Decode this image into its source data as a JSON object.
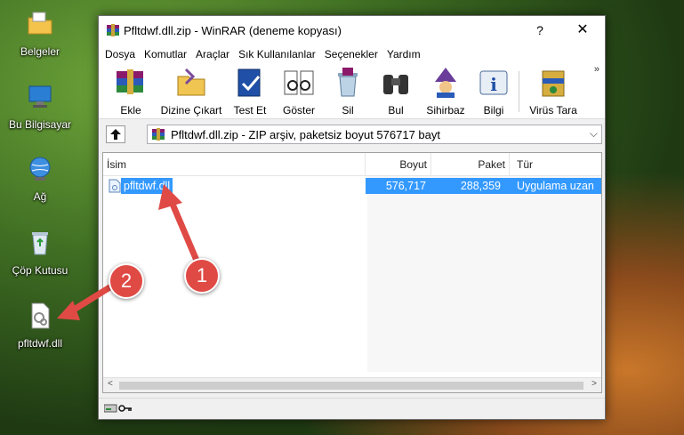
{
  "desktop": {
    "icons": [
      {
        "label": "Belgeler",
        "icon": "folder-icon"
      },
      {
        "label": "Bu Bilgisayar",
        "icon": "computer-icon"
      },
      {
        "label": "Ağ",
        "icon": "network-icon"
      },
      {
        "label": "Çöp Kutusu",
        "icon": "recycle-bin-icon"
      },
      {
        "label": "pfltdwf.dll",
        "icon": "dll-file-icon"
      }
    ]
  },
  "window": {
    "title": "Pfltdwf.dll.zip - WinRAR (deneme kopyası)",
    "help_label": "?",
    "close_label": "✕",
    "menu": [
      "Dosya",
      "Komutlar",
      "Araçlar",
      "Sık Kullanılanlar",
      "Seçenekler",
      "Yardım"
    ],
    "toolbar": [
      {
        "label": "Ekle",
        "icon": "add-archive-icon"
      },
      {
        "label": "Dizine Çıkart",
        "icon": "extract-to-icon"
      },
      {
        "label": "Test Et",
        "icon": "test-icon"
      },
      {
        "label": "Göster",
        "icon": "view-icon"
      },
      {
        "label": "Sil",
        "icon": "delete-icon"
      },
      {
        "label": "Bul",
        "icon": "find-icon"
      },
      {
        "label": "Sihirbaz",
        "icon": "wizard-icon"
      },
      {
        "label": "Bilgi",
        "icon": "info-icon"
      },
      {
        "label": "Virüs Tara",
        "icon": "virus-scan-icon"
      }
    ],
    "toolbar_more": "»",
    "address": {
      "text": "Pfltdwf.dll.zip - ZIP arşiv, paketsiz boyut 576717 bayt",
      "dropdown": "⌵"
    },
    "columns": {
      "name": "İsim",
      "size": "Boyut",
      "packed": "Paket",
      "type": "Tür"
    },
    "files": [
      {
        "name": "pfltdwf.dll",
        "size": "576,717",
        "packed": "288,359",
        "type": "Uygulama uzan"
      }
    ],
    "scroll_left": "<",
    "scroll_right": ">"
  },
  "callouts": [
    {
      "number": "1",
      "color": "#e04a45"
    },
    {
      "number": "2",
      "color": "#e04a45"
    }
  ]
}
